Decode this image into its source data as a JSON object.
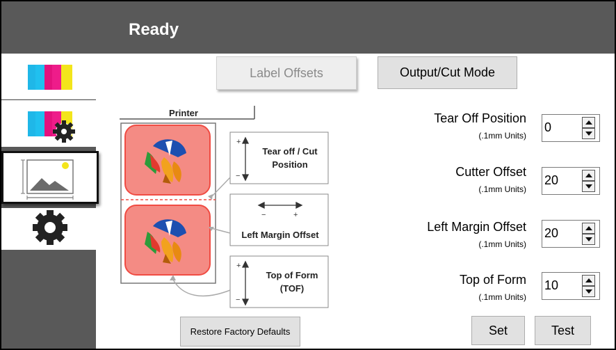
{
  "window": {
    "status_title": "Ready"
  },
  "tabs": {
    "label_offsets": "Label Offsets",
    "output_cut_mode": "Output/Cut Mode"
  },
  "diagram": {
    "printer_label": "Printer",
    "tear_off_cut_position": "Tear off / Cut Position",
    "left_margin_offset": "Left Margin Offset",
    "top_of_form": "Top of Form (TOF)",
    "plus": "+",
    "minus": "−"
  },
  "fields": [
    {
      "label": "Tear Off Position",
      "unit": "(.1mm Units)",
      "value": "0"
    },
    {
      "label": "Cutter Offset",
      "unit": "(.1mm Units)",
      "value": "20"
    },
    {
      "label": "Left Margin Offset",
      "unit": "(.1mm Units)",
      "value": "20"
    },
    {
      "label": "Top of Form",
      "unit": "(.1mm Units)",
      "value": "10"
    }
  ],
  "buttons": {
    "restore_defaults": "Restore Factory Defaults",
    "set": "Set",
    "test": "Test"
  },
  "sidebar": {
    "items": [
      {
        "icon": "cmyk-ink-icon"
      },
      {
        "icon": "ink-settings-icon"
      },
      {
        "icon": "media-image-icon",
        "selected": true
      },
      {
        "icon": "gear-icon"
      }
    ]
  },
  "colors": {
    "header": "#595959",
    "cyan": "#1fb7e8",
    "magenta": "#e3127d",
    "yellow": "#f3e51b",
    "label_pink": "#f48b84",
    "label_border": "#f04c43",
    "gear": "#222222"
  }
}
